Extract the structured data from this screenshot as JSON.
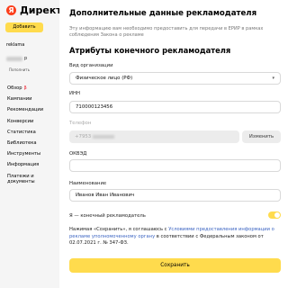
{
  "sidebar": {
    "logo_text": "Директ",
    "logo_mark": "Я",
    "add_button": "Добавить",
    "login": "reklama",
    "login_initial": "р",
    "login_sub": "Пополнить",
    "nav": [
      {
        "label": "Обзор",
        "badge": "β"
      },
      {
        "label": "Кампании"
      },
      {
        "label": "Рекомендации"
      },
      {
        "label": "Конверсии"
      },
      {
        "label": "Статистика"
      },
      {
        "label": "Библиотека"
      },
      {
        "label": "Инструменты"
      },
      {
        "label": "Информация"
      },
      {
        "label": "Платежи и документы"
      }
    ]
  },
  "main": {
    "title": "Дополнительные данные рекламодателя",
    "intro": "Эту информацию вам необходимо предоставить для передачи в ЕРИР в рамках соблюдения Закона о рекламе",
    "subtitle": "Атрибуты конечного рекламодателя",
    "org_type_label": "Вид организации",
    "org_type_value": "Физическое лицо (РФ)",
    "inn_label": "ИНН",
    "inn_value": "710000123456",
    "phone_label": "Телефон",
    "phone_prefix": "+7953",
    "phone_button": "Изменить",
    "okved_label": "ОКВЭД",
    "okved_value": "",
    "name_label": "Наименование",
    "name_value": "Иванов Иван Иванович",
    "toggle_label": "Я — конечный рекламодатель",
    "toggle_on": true,
    "agree_prefix": "Нажимая «Сохранить», я соглашаюсь с ",
    "agree_link": "Условиями предоставления информации о рекламе уполномоченному органу",
    "agree_suffix": " в соответствии с Федеральным законом от 02.07.2021 г. № 347-ФЗ.",
    "save_button": "Сохранить"
  },
  "colors": {
    "accent": "#ffdb4d",
    "link": "#3b64c2",
    "logo": "#fc3f1d"
  }
}
